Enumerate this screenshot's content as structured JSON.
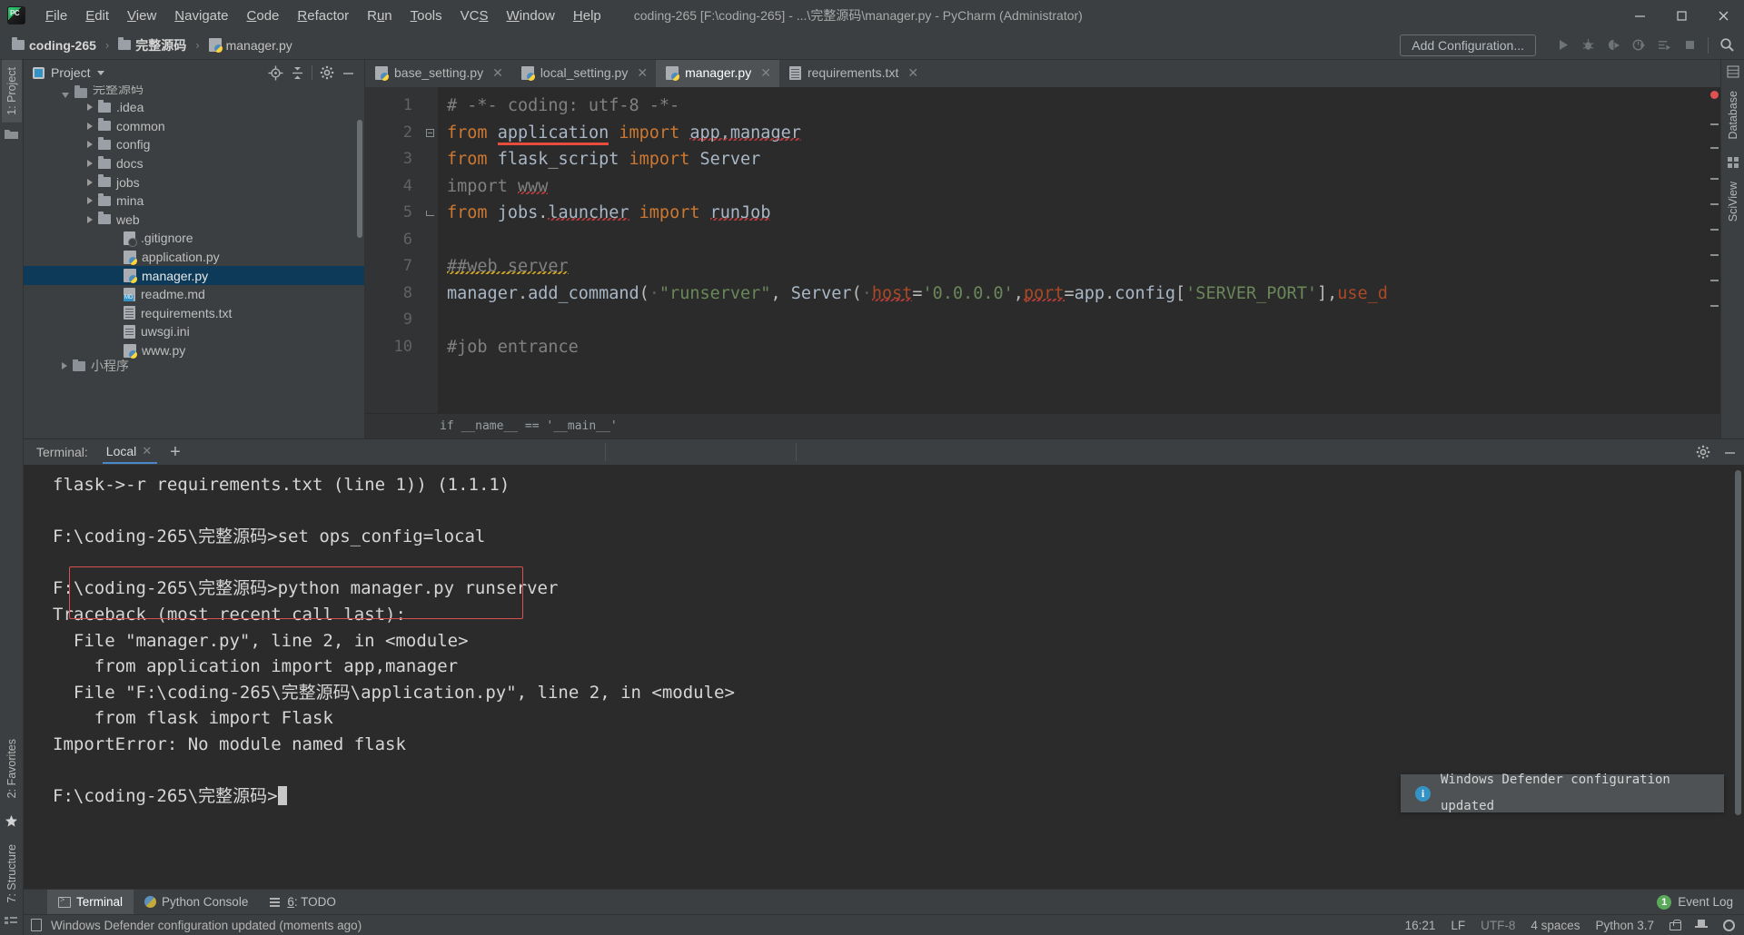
{
  "window": {
    "title": "coding-265 [F:\\coding-265] - ...\\完整源码\\manager.py - PyCharm (Administrator)",
    "minimize": "—",
    "maximize": "❐",
    "close": "✕"
  },
  "menu": {
    "items": [
      {
        "label": "File",
        "mnemonic": "F"
      },
      {
        "label": "Edit",
        "mnemonic": "E"
      },
      {
        "label": "View",
        "mnemonic": "V"
      },
      {
        "label": "Navigate",
        "mnemonic": "N"
      },
      {
        "label": "Code",
        "mnemonic": "C"
      },
      {
        "label": "Refactor",
        "mnemonic": "R"
      },
      {
        "label": "Run",
        "mnemonic": "u"
      },
      {
        "label": "Tools",
        "mnemonic": "T"
      },
      {
        "label": "VCS",
        "mnemonic": "S"
      },
      {
        "label": "Window",
        "mnemonic": "W"
      },
      {
        "label": "Help",
        "mnemonic": "H"
      }
    ]
  },
  "breadcrumb": {
    "items": [
      {
        "label": "coding-265",
        "icon": "folder-icon",
        "bold": true
      },
      {
        "label": "完整源码",
        "icon": "folder-icon",
        "bold": true
      },
      {
        "label": "manager.py",
        "icon": "python-file-icon",
        "bold": false
      }
    ],
    "separator": "›"
  },
  "toolbar": {
    "add_configuration": "Add Configuration...",
    "buttons": [
      {
        "name": "run-button",
        "glyph": "▶"
      },
      {
        "name": "debug-button",
        "glyph": "debug"
      },
      {
        "name": "run-coverage-button",
        "glyph": "coverage"
      },
      {
        "name": "profile-button",
        "glyph": "profile"
      },
      {
        "name": "run-with-console-button",
        "glyph": "console"
      },
      {
        "name": "stop-button",
        "glyph": "■"
      },
      {
        "name": "search-everywhere-button",
        "glyph": "search"
      }
    ]
  },
  "left_strip": {
    "project_tab": "1: Project",
    "favorites_tab": "2: Favorites",
    "structure_tab": "7: Structure"
  },
  "right_strip": {
    "database_tab": "Database",
    "sciview_tab": "SciView"
  },
  "project_panel": {
    "title": "Project",
    "tree": [
      {
        "label": "完整源码",
        "type": "folder",
        "indent": 1,
        "state": "open",
        "selected": false,
        "clipped": true
      },
      {
        "label": ".idea",
        "type": "folder",
        "indent": 2,
        "state": "closed",
        "selected": false
      },
      {
        "label": "common",
        "type": "folder",
        "indent": 2,
        "state": "closed",
        "selected": false
      },
      {
        "label": "config",
        "type": "folder",
        "indent": 2,
        "state": "closed",
        "selected": false
      },
      {
        "label": "docs",
        "type": "folder",
        "indent": 2,
        "state": "closed",
        "selected": false
      },
      {
        "label": "jobs",
        "type": "folder",
        "indent": 2,
        "state": "closed",
        "selected": false
      },
      {
        "label": "mina",
        "type": "folder",
        "indent": 2,
        "state": "closed",
        "selected": false
      },
      {
        "label": "web",
        "type": "folder",
        "indent": 2,
        "state": "closed",
        "selected": false
      },
      {
        "label": ".gitignore",
        "type": "git",
        "indent": 3,
        "state": "none",
        "selected": false
      },
      {
        "label": "application.py",
        "type": "py",
        "indent": 3,
        "state": "none",
        "selected": false
      },
      {
        "label": "manager.py",
        "type": "py",
        "indent": 3,
        "state": "none",
        "selected": true
      },
      {
        "label": "readme.md",
        "type": "md",
        "indent": 3,
        "state": "none",
        "selected": false
      },
      {
        "label": "requirements.txt",
        "type": "txt",
        "indent": 3,
        "state": "none",
        "selected": false
      },
      {
        "label": "uwsgi.ini",
        "type": "ini",
        "indent": 3,
        "state": "none",
        "selected": false
      },
      {
        "label": "www.py",
        "type": "py",
        "indent": 3,
        "state": "none",
        "selected": false
      },
      {
        "label": "小程序",
        "type": "folder",
        "indent": 1,
        "state": "closed",
        "selected": false,
        "clipped": true
      }
    ]
  },
  "editor_tabs": [
    {
      "label": "base_setting.py",
      "icon": "python-file-icon",
      "active": false
    },
    {
      "label": "local_setting.py",
      "icon": "python-file-icon",
      "active": false
    },
    {
      "label": "manager.py",
      "icon": "python-file-icon",
      "active": true
    },
    {
      "label": "requirements.txt",
      "icon": "text-file-icon",
      "active": false
    }
  ],
  "editor": {
    "line_numbers": [
      "1",
      "2",
      "3",
      "4",
      "5",
      "6",
      "7",
      "8",
      "9",
      "10"
    ],
    "lines": [
      "# -*- coding: utf-8 -*-",
      "from application import app,manager",
      "from flask_script import Server",
      "import www",
      "from jobs.launcher import runJob",
      "",
      "##web server",
      "manager.add_command( \"runserver\", Server( host='0.0.0.0',port=app.config['SERVER_PORT'],use_d",
      "",
      "#job entrance"
    ],
    "preview_line": "if __name__ == '__main__'"
  },
  "terminal": {
    "label": "Terminal:",
    "tab": "Local",
    "add_tab": "+",
    "lines": [
      "flask->-r requirements.txt (line 1)) (1.1.1)",
      "",
      "F:\\coding-265\\完整源码>set ops_config=local",
      "",
      "F:\\coding-265\\完整源码>python manager.py runserver",
      "Traceback (most recent call last):",
      "  File \"manager.py\", line 2, in <module>",
      "    from application import app,manager",
      "  File \"F:\\coding-265\\完整源码\\application.py\", line 2, in <module>",
      "    from flask import Flask",
      "ImportError: No module named flask",
      "",
      "F:\\coding-265\\完整源码>"
    ]
  },
  "notification": {
    "text": "Windows Defender configuration updated",
    "icon": "info-icon"
  },
  "bottom_tabs": [
    {
      "label": "Terminal",
      "icon": "terminal-icon",
      "active": true
    },
    {
      "label": "Python Console",
      "icon": "python-console-icon",
      "active": false
    },
    {
      "label": "6: TODO",
      "icon": "todo-icon",
      "active": false,
      "mnemonic": "6"
    }
  ],
  "event_log": {
    "count": "1",
    "label": "Event Log"
  },
  "statusbar": {
    "message": "Windows Defender configuration updated (moments ago)",
    "time": "16:21",
    "line_separator": "LF",
    "encoding": "UTF-8",
    "indent": "4 spaces",
    "interpreter": "Python 3.7"
  },
  "colors": {
    "accent": "#3592c4",
    "selection": "#0d3a58",
    "error": "#e74c3c",
    "keyword": "#cc7832",
    "string": "#6a8759",
    "number": "#6897bb",
    "comment": "#808080",
    "identifier": "#a9b7c6",
    "panel_bg": "#3c3f41",
    "editor_bg": "#2b2b2b"
  }
}
